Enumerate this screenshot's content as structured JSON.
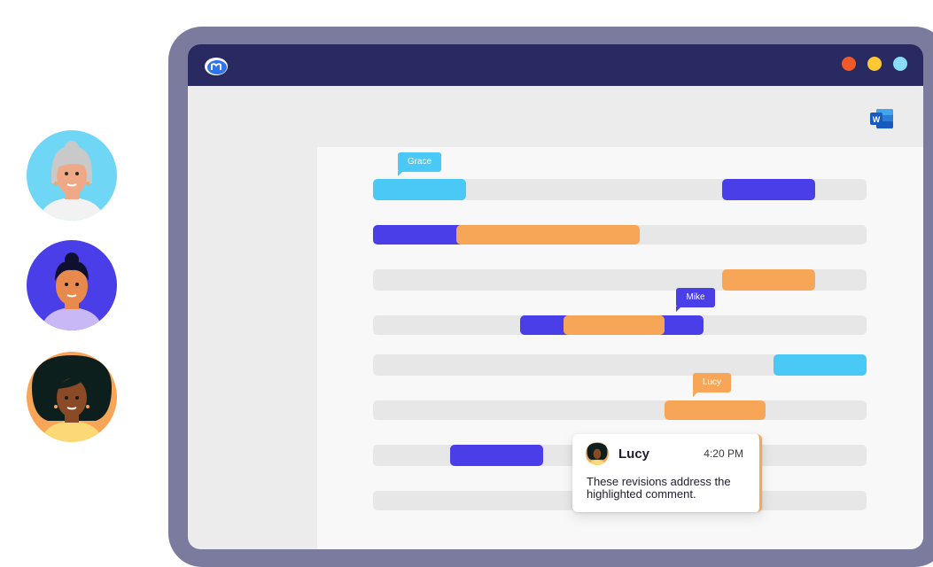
{
  "window": {
    "app_logo_icon": "m-logo-icon",
    "title_bar_color": "#2a2a63",
    "window_controls": [
      {
        "name": "close",
        "color": "#f05a28"
      },
      {
        "name": "minimize",
        "color": "#fcc933"
      },
      {
        "name": "maximize",
        "color": "#89dcf6"
      }
    ],
    "word_icon": "microsoft-word-icon",
    "word_icon_letter": "W"
  },
  "collaborators": [
    {
      "name": "Grace",
      "color": "#4ac9f6"
    },
    {
      "name": "Mike",
      "color": "#4a3ee8"
    },
    {
      "name": "Lucy",
      "color": "#f6a656"
    }
  ],
  "cursor_tags": {
    "grace": "Grace",
    "mike": "Mike",
    "lucy": "Lucy"
  },
  "comment": {
    "author": "Lucy",
    "time": "4:20 PM",
    "text": "These revisions address the highlighted comment."
  }
}
